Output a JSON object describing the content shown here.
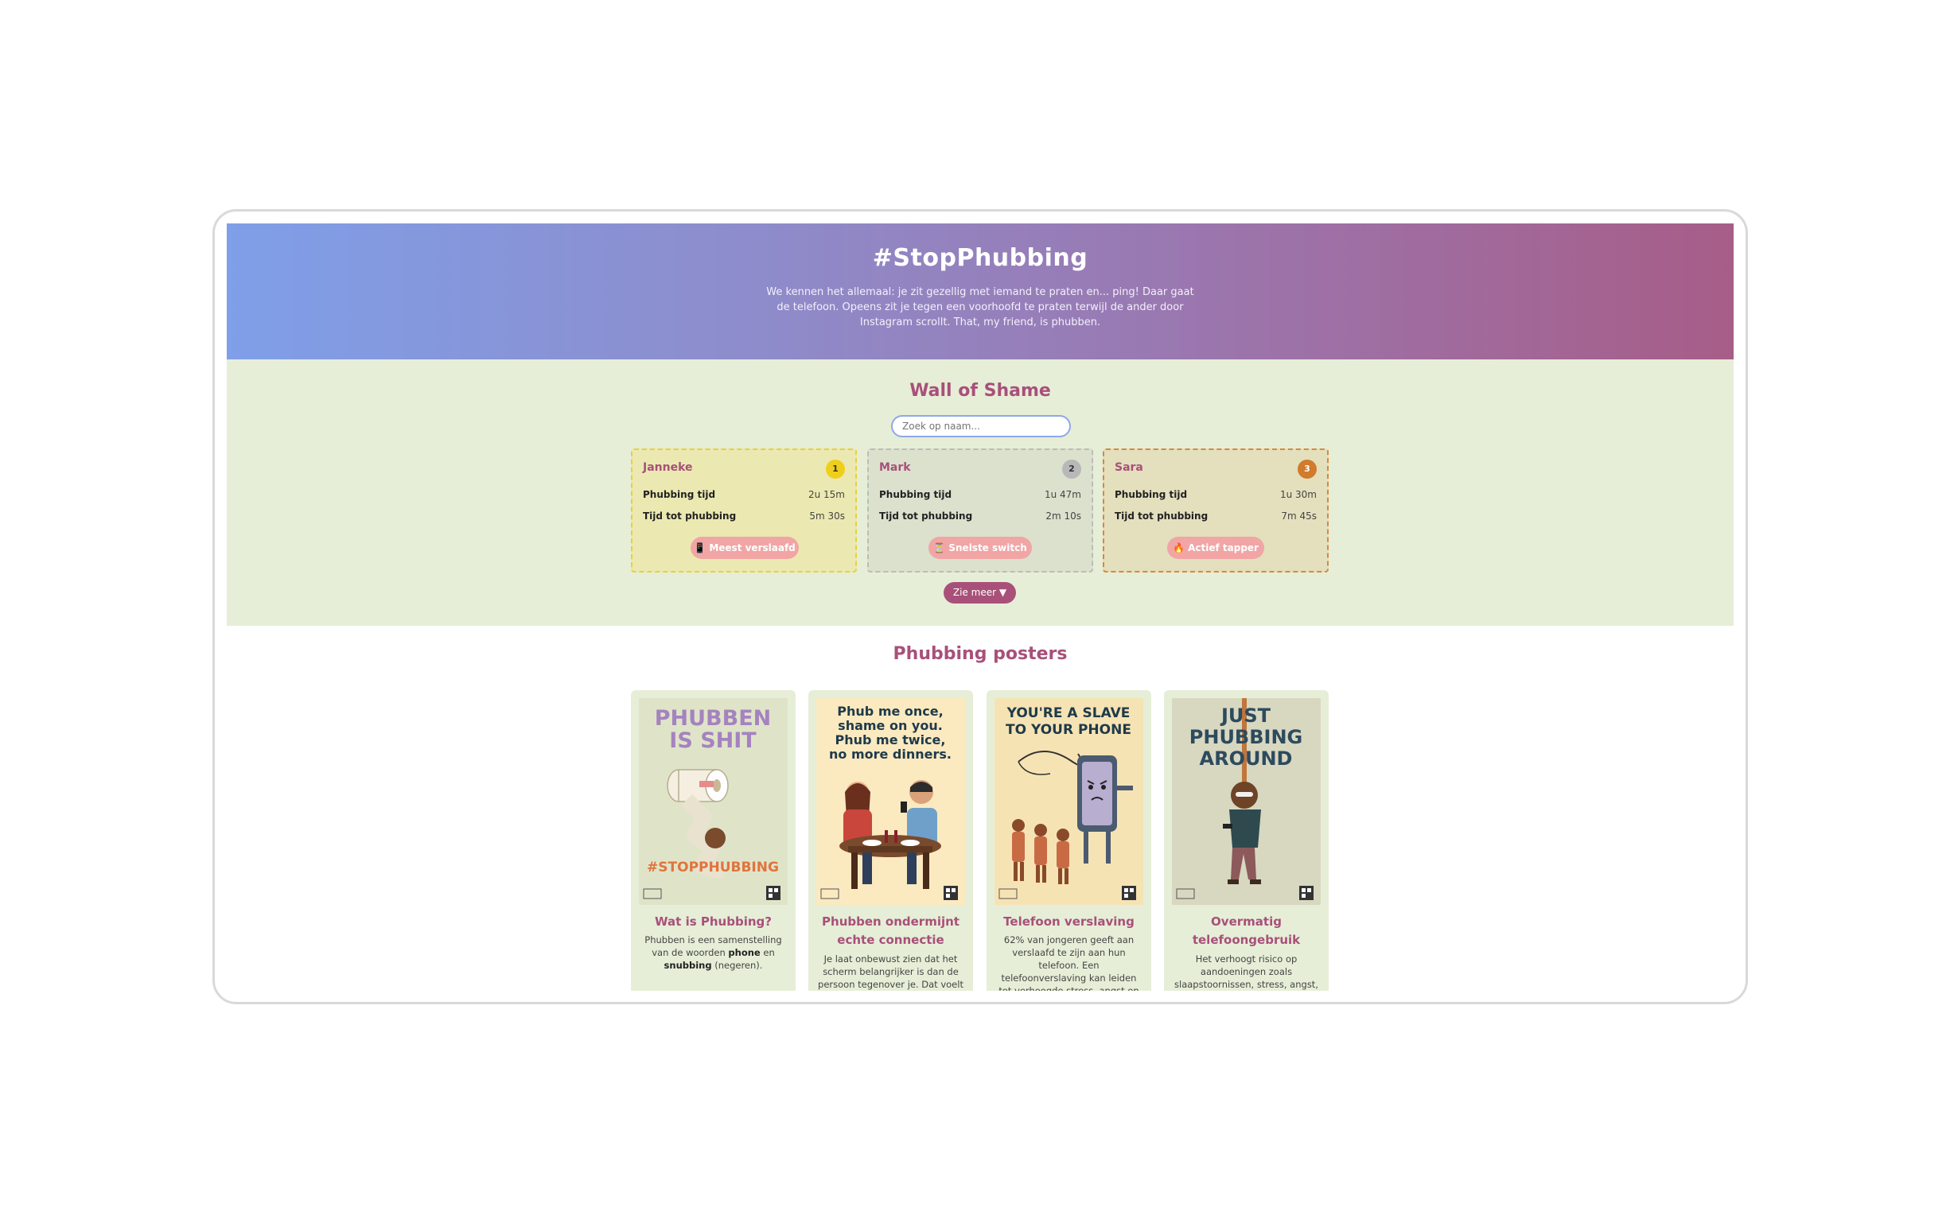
{
  "hero": {
    "title": "#StopPhubbing",
    "intro": "We kennen het allemaal: je zit gezellig met iemand te praten en... ping! Daar gaat de telefoon. Opeens zit je tegen een voorhoofd te praten terwijl de ander door Instagram scrollt. That, my friend, is phubben."
  },
  "wall": {
    "title": "Wall of Shame",
    "search_placeholder": "Zoek op naam...",
    "see_more_label": "Zie meer ▼",
    "stat_labels": {
      "time": "Phubbing tijd",
      "until": "Tijd tot phubbing"
    },
    "cards": [
      {
        "name": "Janneke",
        "rank": "1",
        "phubbing_time": "2u 15m",
        "time_to_phubbing": "5m 30s",
        "tag": "📱 Meest verslaafd"
      },
      {
        "name": "Mark",
        "rank": "2",
        "phubbing_time": "1u 47m",
        "time_to_phubbing": "2m 10s",
        "tag": "⏳ Snelste switch"
      },
      {
        "name": "Sara",
        "rank": "3",
        "phubbing_time": "1u 30m",
        "time_to_phubbing": "7m 45s",
        "tag": "🔥 Actief tapper"
      }
    ]
  },
  "posters": {
    "title": "Phubbing posters",
    "items": [
      {
        "poster_text": [
          "PHUBBEN",
          "IS SHIT"
        ],
        "poster_footer": "#STOPPHUBBING",
        "title": "Wat is Phubbing?",
        "text_before": "Phubben is een samenstelling van de woorden ",
        "bold1": "phone",
        "text_mid": " en ",
        "bold2": "snubbing",
        "text_after": " (negeren)."
      },
      {
        "poster_text": [
          "Phub me once,",
          "shame on you.",
          "Phub me twice,",
          "no more dinners."
        ],
        "title": "Phubben ondermijnt echte connectie",
        "text": "Je laat onbewust zien dat het scherm belangrijker is dan de persoon tegenover je. Dat voelt"
      },
      {
        "poster_text": [
          "YOU'RE A SLAVE",
          "TO YOUR PHONE"
        ],
        "title": "Telefoon verslaving",
        "text": "62% van jongeren geeft aan verslaafd te zijn aan hun telefoon. Een telefoonverslaving kan leiden tot verhoogde stress, angst en"
      },
      {
        "poster_text": [
          "JUST",
          "PHUBBING",
          "AROUND"
        ],
        "title": "Overmatig telefoongebruik",
        "text": "Het verhoogt risico op aandoeningen zoals slaapstoornissen, stress, angst,"
      }
    ]
  },
  "colors": {
    "accent": "#a8507a",
    "wall_bg": "#e6eed7",
    "pill": "#f2a5a5",
    "gold": "#f0cf1b",
    "silver": "#b8b8b8",
    "bronze": "#d17b2c"
  }
}
